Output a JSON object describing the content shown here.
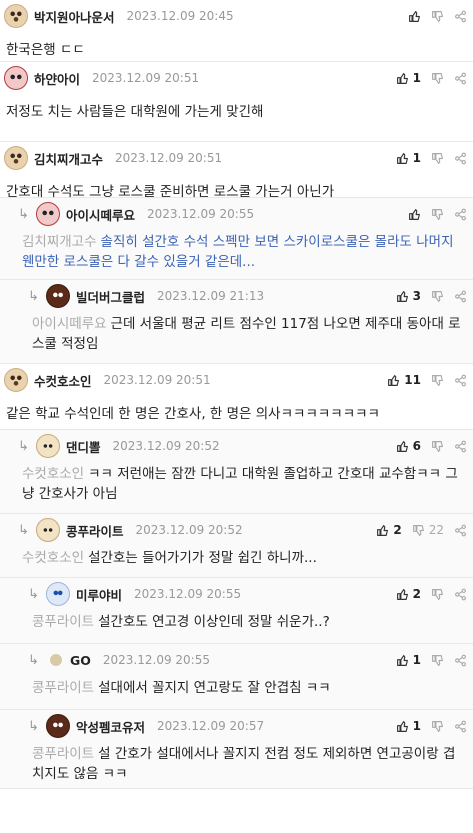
{
  "comments": [
    {
      "nick": "박지원아나운서",
      "date": "2023.12.09 20:45",
      "like": "",
      "dislike": "",
      "text": "한국은행 ㄷㄷ",
      "avatar": "dog"
    },
    {
      "nick": "하얀아이",
      "date": "2023.12.09 20:51",
      "like": "1",
      "dislike": "",
      "text": "저정도 치는 사람들은 대학원에 가는게 맞긴해",
      "avatar": "pink"
    },
    {
      "nick": "김치찌개고수",
      "date": "2023.12.09 20:51",
      "like": "1",
      "dislike": "",
      "text": "간호대 수석도 그냥 로스쿨 준비하면 로스쿨 가는거 아닌가",
      "avatar": "dog"
    },
    {
      "nick": "아이시떼루요",
      "date": "2023.12.09 20:55",
      "like": "",
      "dislike": "",
      "mention": "김치찌개고수",
      "text": "솔직히 설간호 수석 스펙만 보면 스카이로스쿨은 몰라도 나머지 웬만한 로스쿨은 다 갈수 있을거 같은데...",
      "avatar": "pink"
    },
    {
      "nick": "빌더버그클럽",
      "date": "2023.12.09 21:13",
      "like": "3",
      "dislike": "",
      "mention": "아이시떼루요",
      "text": "근데 서울대 평균 리트 점수인 117점 나오면 제주대 동아대 로스쿨 적정임",
      "avatar": "dark"
    },
    {
      "nick": "수컷호소인",
      "date": "2023.12.09 20:51",
      "like": "11",
      "dislike": "",
      "text": "같은 학교 수석인데 한 명은 간호사, 한 명은 의사ㅋㅋㅋㅋㅋㅋㅋㅋ",
      "avatar": "dog"
    },
    {
      "nick": "댄디뽈",
      "date": "2023.12.09 20:52",
      "like": "6",
      "dislike": "",
      "mention": "수컷호소인",
      "text": "ㅋㅋ 저런애는 잠깐 다니고 대학원 졸업하고 간호대 교수함ㅋㅋ 그냥 간호사가 아님",
      "avatar": "fox"
    },
    {
      "nick": "콩푸라이트",
      "date": "2023.12.09 20:52",
      "like": "2",
      "dislike": "22",
      "mention": "수컷호소인",
      "text": "설간호는 들어가기가 정말 쉽긴 하니까...",
      "avatar": "fox"
    },
    {
      "nick": "미루야비",
      "date": "2023.12.09 20:55",
      "like": "2",
      "dislike": "",
      "mention": "콩푸라이트",
      "text": "설간호도 연고경 이상인데 정말 쉬운가..?",
      "avatar": "ghost"
    },
    {
      "nick": "GO",
      "date": "2023.12.09 20:55",
      "like": "1",
      "dislike": "",
      "mention": "콩푸라이트",
      "text": "설대에서 꼴지지 연고랑도 잘 안겹침 ㅋㅋ",
      "avatar": "dot"
    },
    {
      "nick": "악성펨코유저",
      "date": "2023.12.09 20:57",
      "like": "1",
      "dislike": "",
      "mention": "콩푸라이트",
      "text": "설 간호가 설대에서나 꼴지지 전컴 정도 제외하면 연고공이랑 겹치지도 않음 ㅋㅋ",
      "avatar": "dark"
    }
  ],
  "icons": {
    "like": "thumbs-up-icon",
    "dislike": "thumbs-down-icon",
    "share": "share-icon",
    "reply": "reply-arrow-icon"
  },
  "colors": {
    "mention": "#aaaaaa",
    "highlight": "#3b63b5",
    "border": "#e8e8e8"
  }
}
